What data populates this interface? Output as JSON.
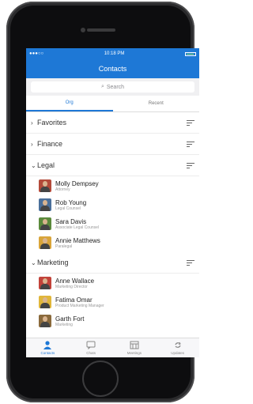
{
  "status": {
    "carrier": "●●●○○",
    "time": "10:18 PM",
    "wifi": "wifi-icon"
  },
  "nav": {
    "title": "Contacts"
  },
  "search": {
    "placeholder": "Search",
    "icon": "search-icon"
  },
  "segments": [
    {
      "label": "Org"
    },
    {
      "label": "Recent"
    }
  ],
  "groups": [
    {
      "label": "Favorites",
      "expanded": false
    },
    {
      "label": "Finance",
      "expanded": false
    },
    {
      "label": "Legal",
      "expanded": true,
      "contacts": [
        {
          "name": "Molly Dempsey",
          "subtitle": "Attorney",
          "color": "#b34a3a"
        },
        {
          "name": "Rob Young",
          "subtitle": "Legal Counsel",
          "color": "#4a6f9a"
        },
        {
          "name": "Sara Davis",
          "subtitle": "Associate Legal Counsel",
          "color": "#5b8a3c"
        },
        {
          "name": "Annie Matthews",
          "subtitle": "Paralegal",
          "color": "#d9a53a"
        }
      ]
    },
    {
      "label": "Marketing",
      "expanded": true,
      "contacts": [
        {
          "name": "Anne Wallace",
          "subtitle": "Marketing Director",
          "color": "#c2433a"
        },
        {
          "name": "Fatima Omar",
          "subtitle": "Product Marketing Manager",
          "color": "#e0b63b"
        },
        {
          "name": "Garth Fort",
          "subtitle": "Marketing",
          "color": "#8a6a3c"
        }
      ]
    }
  ],
  "tabs": [
    {
      "label": "Contacts",
      "active": true
    },
    {
      "label": "Chats",
      "active": false
    },
    {
      "label": "Meetings",
      "active": false
    },
    {
      "label": "Updates",
      "active": false
    }
  ],
  "colors": {
    "accent": "#1e78d6"
  }
}
